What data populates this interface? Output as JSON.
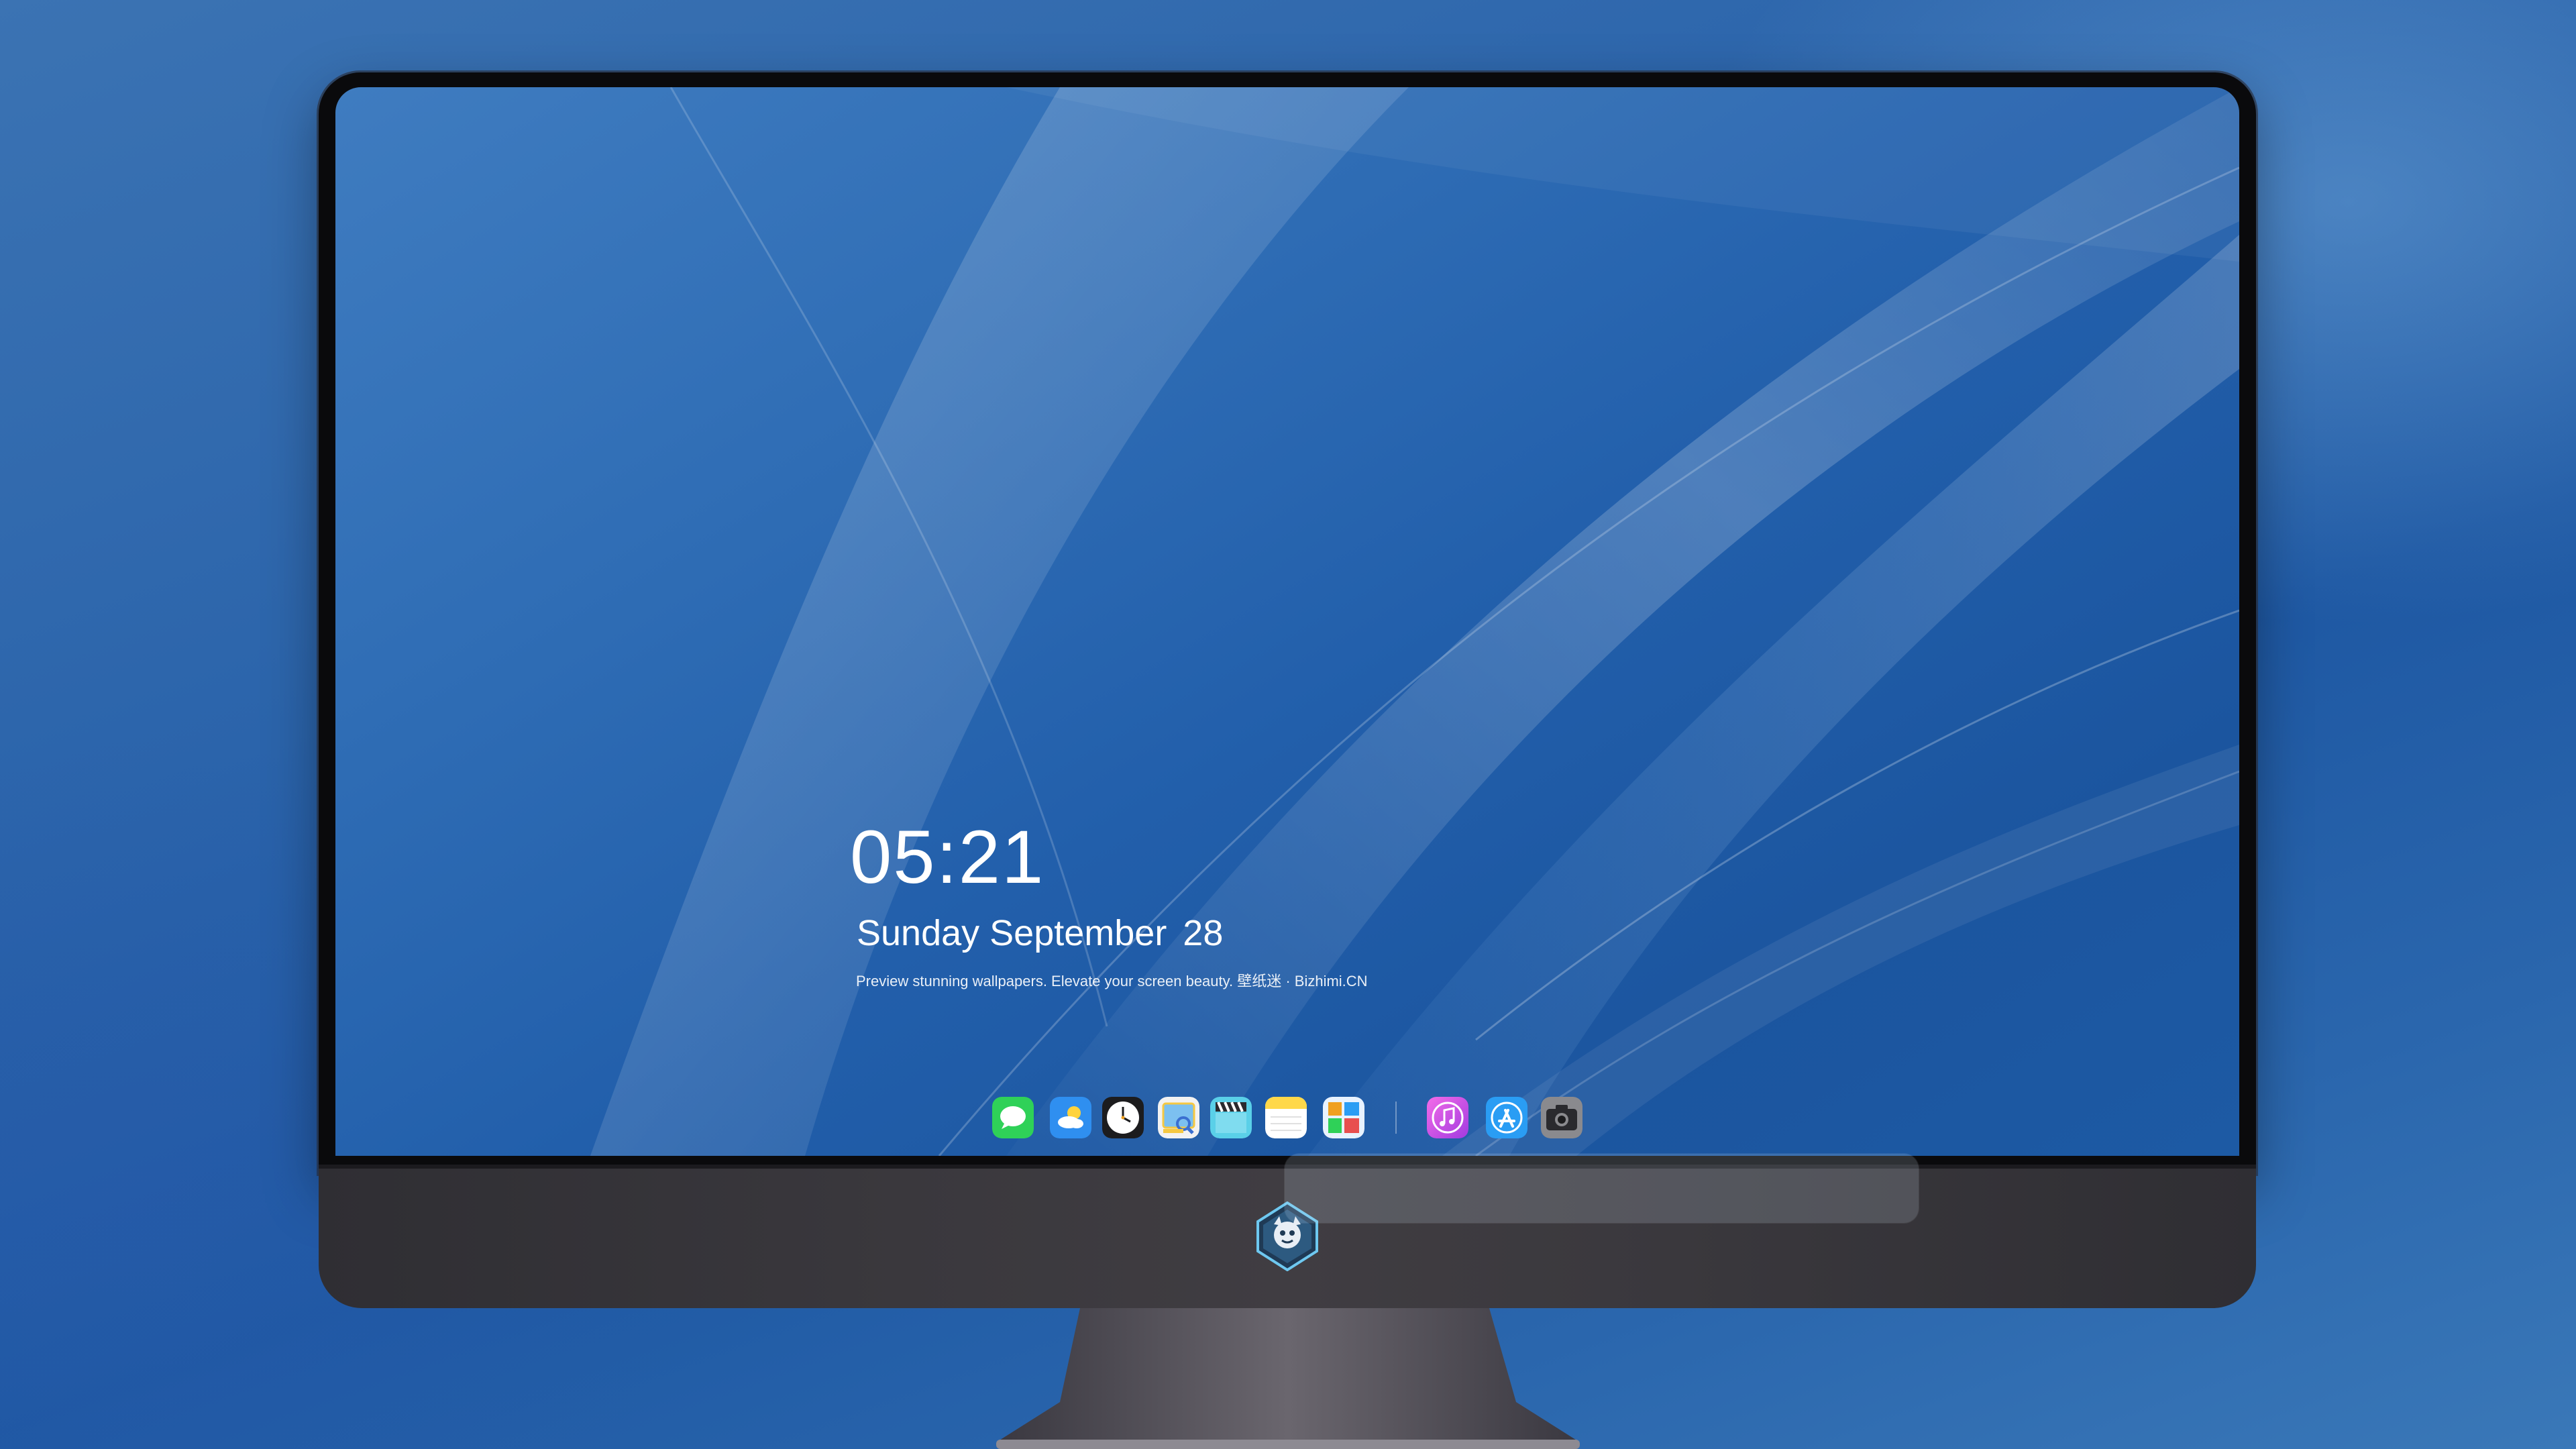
{
  "lock_screen": {
    "time": "05:21",
    "weekday_month": "Sunday September",
    "day": "28",
    "tagline": "Preview stunning wallpapers. Elevate your screen beauty. 壁纸迷 · Bizhimi.CN"
  },
  "dock": {
    "apps": [
      {
        "name": "messages",
        "icon": "chat-bubble-icon",
        "color": "#2fd158"
      },
      {
        "name": "weather",
        "icon": "weather-icon",
        "color": "#2f8ff0"
      },
      {
        "name": "clock",
        "icon": "clock-icon",
        "color": "#ffffff"
      },
      {
        "name": "preview",
        "icon": "preview-icon",
        "color": "#f5c842"
      },
      {
        "name": "video",
        "icon": "clapperboard-icon",
        "color": "#5ad0e8"
      },
      {
        "name": "notes",
        "icon": "notes-icon",
        "color": "#ffd84a"
      },
      {
        "name": "photos",
        "icon": "photo-grid-icon",
        "color": "#8ec7ff"
      },
      {
        "name": "music",
        "icon": "music-note-icon",
        "color": "#e84fd8"
      },
      {
        "name": "app-store",
        "icon": "app-store-icon",
        "color": "#2a9df4"
      },
      {
        "name": "camera",
        "icon": "camera-icon",
        "color": "#8a8a8e"
      }
    ]
  },
  "colors": {
    "desktop_bg": "#2b64ab",
    "bezel": "#0a0a0c",
    "chin": "#3a383d",
    "text": "#ffffff"
  }
}
